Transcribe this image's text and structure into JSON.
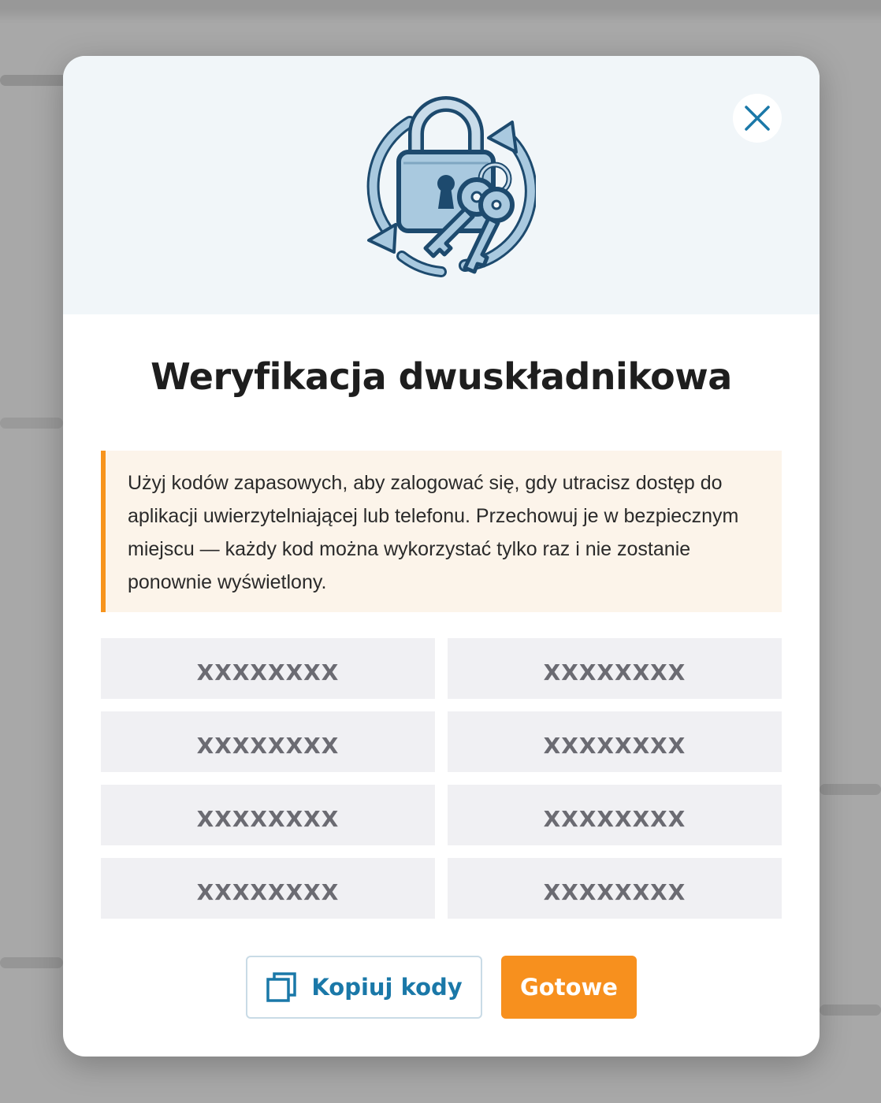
{
  "modal": {
    "title": "Weryfikacja dwuskładnikowa",
    "notice": "Użyj kodów zapasowych, aby zalogować się, gdy utracisz dostęp do aplikacji uwierzytelniającej lub telefonu. Przechowuj je w bezpiecznym miejscu — każdy kod można wykorzystać tylko raz i nie zostanie ponownie wyświetlony.",
    "codes": [
      "XXXXXXXX",
      "XXXXXXXX",
      "XXXXXXXX",
      "XXXXXXXX",
      "XXXXXXXX",
      "XXXXXXXX",
      "XXXXXXXX",
      "XXXXXXXX"
    ],
    "copy_label": "Kopiuj kody",
    "done_label": "Gotowe",
    "icons": {
      "close": "close-icon",
      "copy": "copy-icon",
      "illustration": "lock-keys-illustration"
    }
  },
  "colors": {
    "accent_orange": "#f7901e",
    "accent_blue": "#1a78a8",
    "header_bg": "#f1f6f9",
    "notice_bg": "#fcf4ea"
  }
}
